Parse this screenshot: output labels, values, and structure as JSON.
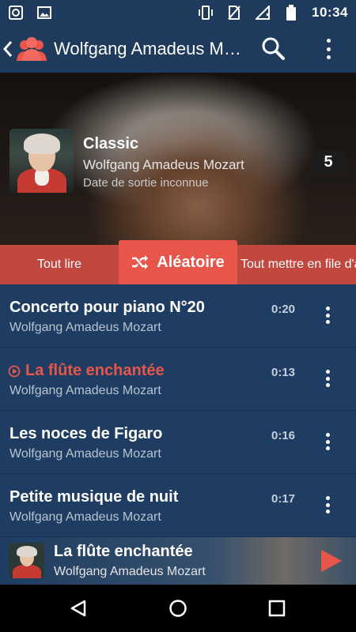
{
  "status_bar": {
    "time": "10:34",
    "left_icons": [
      "media-icon",
      "image-icon"
    ],
    "right_icons": [
      "vibrate-icon",
      "no-sim-icon",
      "signal-icon",
      "battery-icon"
    ]
  },
  "app_bar": {
    "title": "Wolfgang Amadeus Mozart",
    "icons": [
      "back-icon",
      "artists-icon",
      "search-icon",
      "overflow-menu-icon"
    ]
  },
  "album": {
    "title": "Classic",
    "artist": "Wolfgang Amadeus Mozart",
    "release": "Date de sortie inconnue",
    "track_count": "5"
  },
  "actions": {
    "play_all": "Tout lire",
    "shuffle": "Aléatoire",
    "queue_all": "Tout mettre en file d'attente"
  },
  "tracks": [
    {
      "title": "Concerto pour piano N°20",
      "artist": "Wolfgang Amadeus Mozart",
      "duration": "0:20",
      "playing": false
    },
    {
      "title": "La flûte enchantée",
      "artist": "Wolfgang Amadeus Mozart",
      "duration": "0:13",
      "playing": true
    },
    {
      "title": "Les noces de Figaro",
      "artist": "Wolfgang Amadeus Mozart",
      "duration": "0:16",
      "playing": false
    },
    {
      "title": "Petite musique de nuit",
      "artist": "Wolfgang Amadeus Mozart",
      "duration": "0:17",
      "playing": false
    }
  ],
  "now_playing": {
    "title": "La flûte enchantée",
    "artist": "Wolfgang Amadeus Mozart"
  },
  "colors": {
    "primary": "#1f3d62",
    "accent": "#e8554b",
    "accent_dark": "#c1473f"
  }
}
